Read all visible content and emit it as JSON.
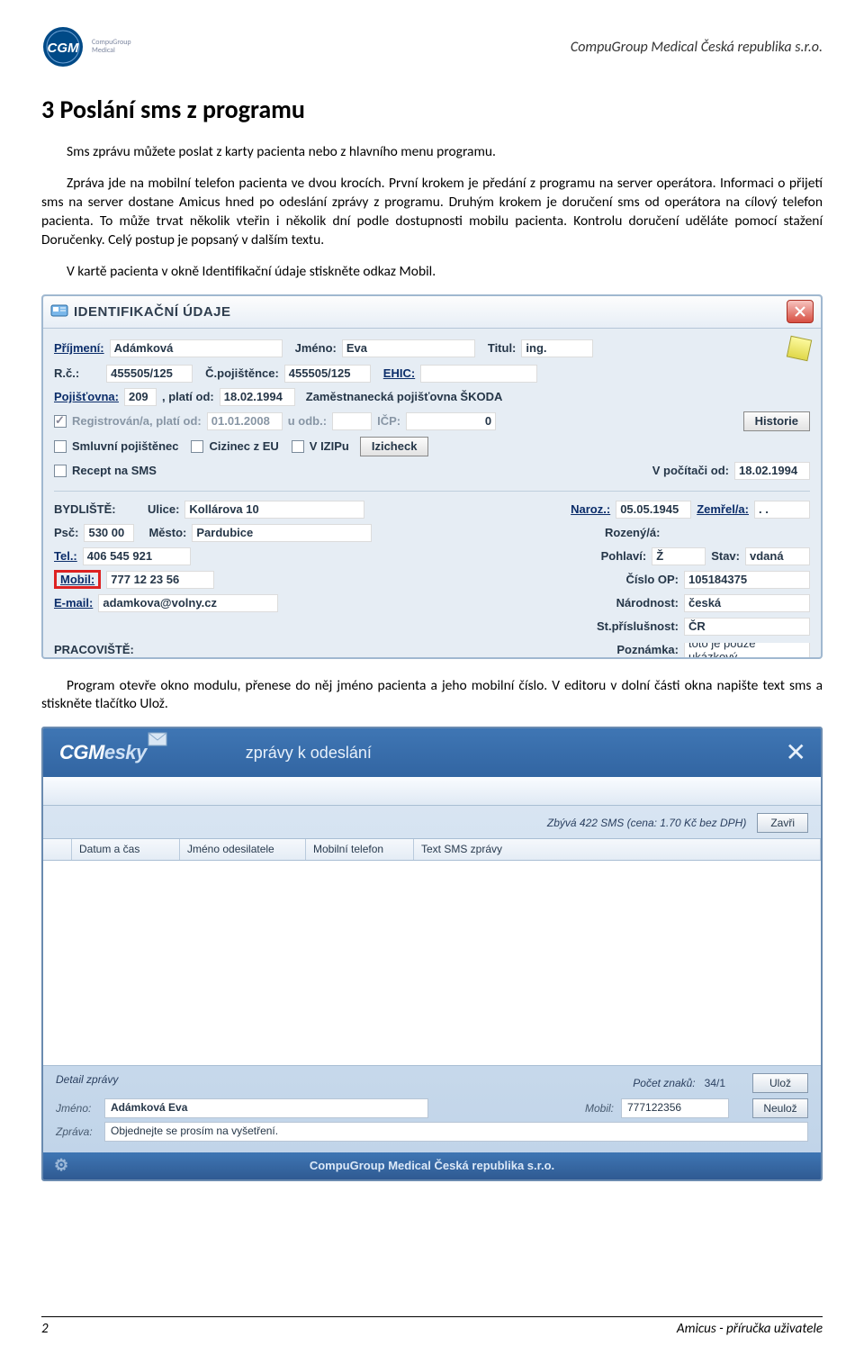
{
  "header": {
    "company": "CompuGroup Medical Česká republika s.r.o."
  },
  "logo": {
    "major": "CGM",
    "minor_line1": "CompuGroup",
    "minor_line2": "Medical"
  },
  "section": {
    "title": "3  Poslání sms z programu"
  },
  "para1": "Sms zprávu můžete poslat z karty pacienta nebo z hlavního menu programu.",
  "para2": "Zpráva jde na mobilní telefon pacienta ve dvou krocích. První krokem je předání z programu na server operátora. Informaci o přijetí sms na server dostane Amicus hned po odeslání zprávy z programu. Druhým krokem je doručení sms od operátora na cílový telefon pacienta. To může trvat několik vteřin i několik dní podle dostupnosti mobilu pacienta. Kontrolu doručení uděláte pomocí stažení Doručenky. Celý postup je popsaný v dalším textu.",
  "para3": "V kartě pacienta v okně Identifikační údaje stiskněte odkaz Mobil.",
  "para4": "Program otevře okno modulu, přenese do něj jméno pacienta a jeho mobilní číslo. V editoru v dolní části okna napište text sms a stiskněte tlačítko Ulož.",
  "idwin": {
    "title": "IDENTIFIKAČNÍ ÚDAJE",
    "prijmeni_lbl": "Příjmení:",
    "prijmeni": "Adámková",
    "jmeno_lbl": "Jméno:",
    "jmeno": "Eva",
    "titul_lbl": "Titul:",
    "titul": "ing.",
    "rc_lbl": "R.č.:",
    "rc": "455505/125",
    "cpoj_lbl": "Č.pojištěnce:",
    "cpoj": "455505/125",
    "ehic": "EHIC:",
    "poj_lbl": "Pojišťovna:",
    "poj_code": "209",
    "plati_od_lbl": ", platí od:",
    "plati_od": "18.02.1994",
    "poj_name": "Zaměstnanecká pojišťovna ŠKODA",
    "reg_lbl": "Registrován/a, platí od:",
    "reg_od": "01.01.2008",
    "uodb_lbl": "u odb.:",
    "icp_lbl": "IČP:",
    "icp": "0",
    "historie": "Historie",
    "smluvni": "Smluvní pojištěnec",
    "cizinec": "Cizinec z EU",
    "vizipu": "V IZIPu",
    "izicheck": "Izicheck",
    "recept": "Recept na SMS",
    "vpoc_lbl": "V počítači od:",
    "vpoc": "18.02.1994",
    "bydliste": "BYDLIŠTĚ:",
    "ulice_lbl": "Ulice:",
    "ulice": "Kollárova 10",
    "naroz_lbl": "Naroz.:",
    "naroz": "05.05.1945",
    "zemrel_lbl": "Zemřel/a:",
    "zemrel": ".  .",
    "psc_lbl": "Psč:",
    "psc": "530 00",
    "mesto_lbl": "Město:",
    "mesto": "Pardubice",
    "rozeny_lbl": "Rozený/á:",
    "tel_lbl": "Tel.:",
    "tel": "406 545 921",
    "pohlavi_lbl": "Pohlaví:",
    "pohlavi": "Ž",
    "stav_lbl": "Stav:",
    "stav": "vdaná",
    "mobil_lbl": "Mobil:",
    "mobil": "777 12 23 56",
    "cop_lbl": "Číslo OP:",
    "cop": "105184375",
    "email_lbl": "E-mail:",
    "email": "adamkova@volny.cz",
    "narodnost_lbl": "Národnost:",
    "narodnost": "česká",
    "stpris_lbl": "St.příslušnost:",
    "stpris": "ČR",
    "pracoviste": "PRACOVIŠTĚ:",
    "poznamka_lbl": "Poznámka:",
    "poznamka": "toto je pouze ukázkový"
  },
  "cgm": {
    "brand_a": "CGM",
    "brand_b": "esky",
    "head_title": "zprávy k odeslání",
    "status": "Zbývá 422 SMS (cena: 1.70 Kč bez DPH)",
    "btn_close": "Zavři",
    "cols": {
      "c1": "Datum a čas",
      "c2": "Jméno odesilatele",
      "c3": "Mobilní telefon",
      "c4": "Text SMS zprávy"
    },
    "detail_title": "Detail zprávy",
    "count_lbl": "Počet znaků:",
    "count": "34/1",
    "btn_save": "Ulož",
    "btn_nosave": "Neulož",
    "jmeno_lbl": "Jméno:",
    "jmeno": "Adámková Eva",
    "mobil_lbl": "Mobil:",
    "mobil": "777122356",
    "zprava_lbl": "Zpráva:",
    "zprava": "Objednejte se prosím na vyšetření.",
    "footer": "CompuGroup Medical Česká republika s.r.o."
  },
  "footer": {
    "page": "2",
    "title": "Amicus - příručka uživatele"
  }
}
